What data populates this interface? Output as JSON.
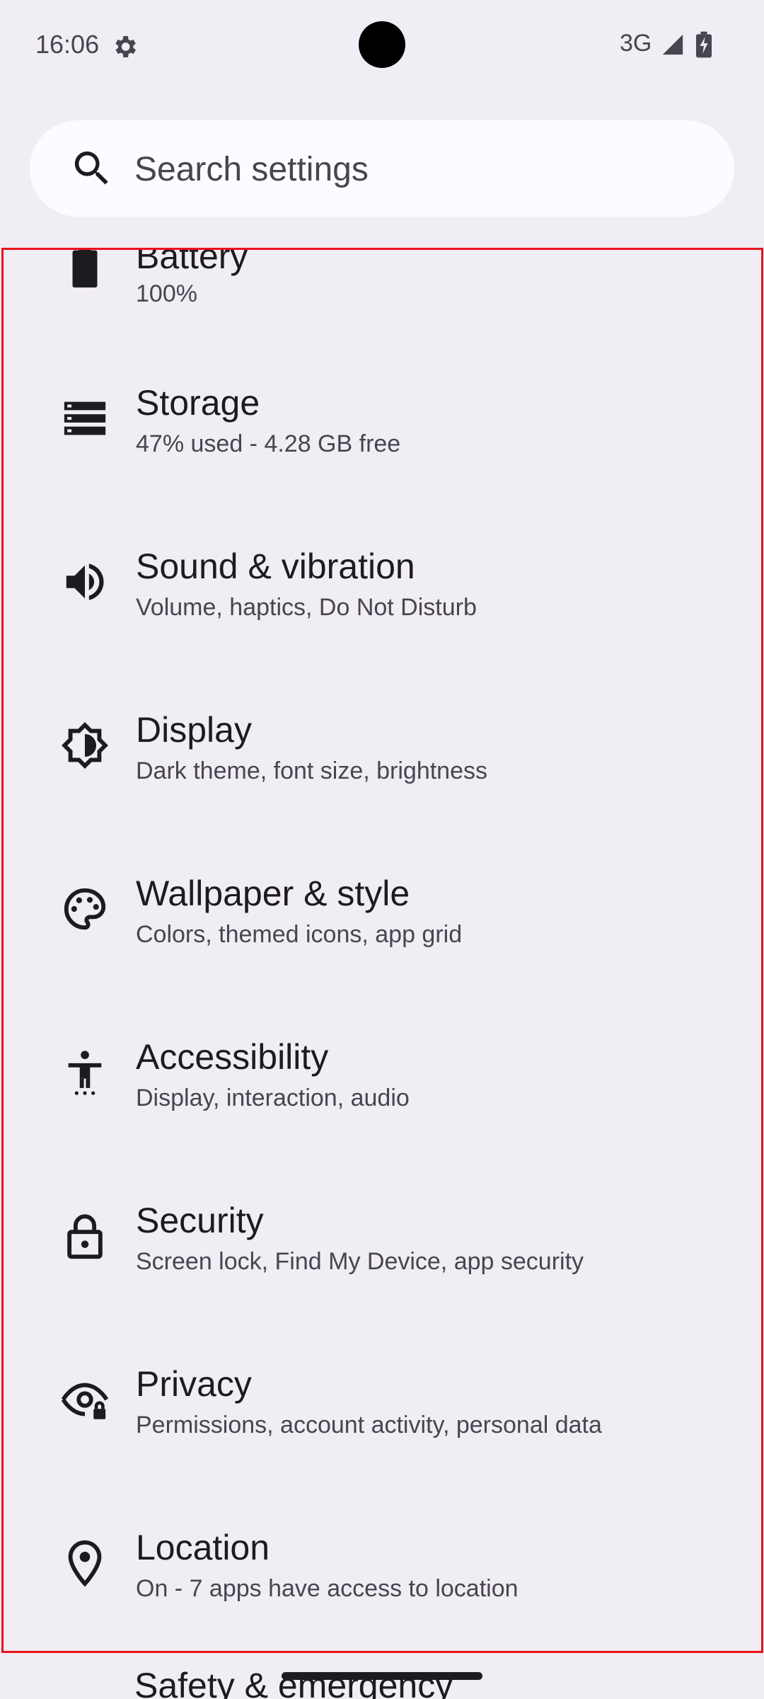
{
  "status_bar": {
    "time": "16:06",
    "network": "3G",
    "icons": [
      "settings-gear-icon",
      "signal-icon",
      "battery-charging-icon"
    ]
  },
  "search": {
    "placeholder": "Search settings",
    "icon": "search-icon"
  },
  "settings": [
    {
      "title": "Battery",
      "subtitle": "100%",
      "icon": "battery-icon"
    },
    {
      "title": "Storage",
      "subtitle": "47% used - 4.28 GB free",
      "icon": "storage-icon"
    },
    {
      "title": "Sound & vibration",
      "subtitle": "Volume, haptics, Do Not Disturb",
      "icon": "volume-icon"
    },
    {
      "title": "Display",
      "subtitle": "Dark theme, font size, brightness",
      "icon": "brightness-icon"
    },
    {
      "title": "Wallpaper & style",
      "subtitle": "Colors, themed icons, app grid",
      "icon": "palette-icon"
    },
    {
      "title": "Accessibility",
      "subtitle": "Display, interaction, audio",
      "icon": "accessibility-icon"
    },
    {
      "title": "Security",
      "subtitle": "Screen lock, Find My Device, app security",
      "icon": "lock-icon"
    },
    {
      "title": "Privacy",
      "subtitle": "Permissions, account activity, personal data",
      "icon": "privacy-eye-icon"
    },
    {
      "title": "Location",
      "subtitle": "On - 7 apps have access to location",
      "icon": "location-pin-icon"
    }
  ],
  "next_item_peek": "Safety & emergency",
  "colors": {
    "background": "#f1edf4",
    "search_bg": "#fdfbff",
    "title_text": "#1d1b20",
    "subtitle_text": "#49454f",
    "highlight_border": "#e8121d"
  }
}
